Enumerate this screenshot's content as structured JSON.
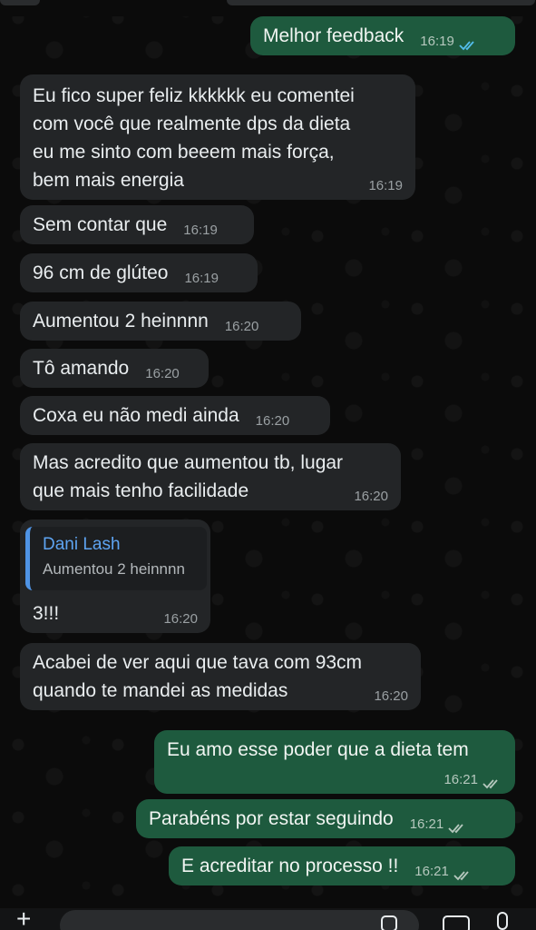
{
  "messages": [
    {
      "id": "m1",
      "dir": "out",
      "text": "Melhor feedback",
      "time": "16:19",
      "status": "read"
    },
    {
      "id": "m2",
      "dir": "in",
      "lines": [
        "Eu fico super feliz kkkkkk eu comentei",
        "com você que realmente dps da dieta",
        "eu me sinto com beeem mais força,",
        "bem mais energia"
      ],
      "time": "16:19"
    },
    {
      "id": "m3",
      "dir": "in",
      "text": "Sem contar que",
      "time": "16:19"
    },
    {
      "id": "m4",
      "dir": "in",
      "text": "96 cm de glúteo",
      "time": "16:19"
    },
    {
      "id": "m5",
      "dir": "in",
      "text": "Aumentou 2 heinnnn",
      "time": "16:20"
    },
    {
      "id": "m6",
      "dir": "in",
      "text": "Tô amando",
      "time": "16:20"
    },
    {
      "id": "m7",
      "dir": "in",
      "text": "Coxa eu não medi ainda",
      "time": "16:20"
    },
    {
      "id": "m8",
      "dir": "in",
      "lines": [
        "Mas acredito que aumentou tb, lugar",
        "que mais tenho facilidade"
      ],
      "time": "16:20"
    },
    {
      "id": "m9",
      "dir": "in",
      "quote": {
        "author": "Dani Lash",
        "text": "Aumentou 2 heinnnn"
      },
      "text": "3!!!",
      "time": "16:20"
    },
    {
      "id": "m10",
      "dir": "in",
      "lines": [
        "Acabei de ver aqui que tava com 93cm",
        "quando te mandei as medidas"
      ],
      "time": "16:20"
    },
    {
      "id": "m11",
      "dir": "out",
      "text": "Eu amo esse poder que a dieta tem",
      "time": "16:21",
      "status": "delivered"
    },
    {
      "id": "m12",
      "dir": "out",
      "text": "Parabéns por estar seguindo",
      "time": "16:21",
      "status": "delivered"
    },
    {
      "id": "m13",
      "dir": "out",
      "text": "E acreditar no processo !!",
      "time": "16:21",
      "status": "delivered"
    }
  ],
  "colors": {
    "incoming_bubble": "#232527",
    "outgoing_bubble": "#1e5a3e",
    "read_ticks": "#53bdeb",
    "delivered_ticks": "#b6c8be",
    "quote_bar": "#4f94e6"
  },
  "composer": {
    "icons": [
      "plus-icon",
      "sticker-icon",
      "camera-icon",
      "microphone-icon"
    ]
  }
}
